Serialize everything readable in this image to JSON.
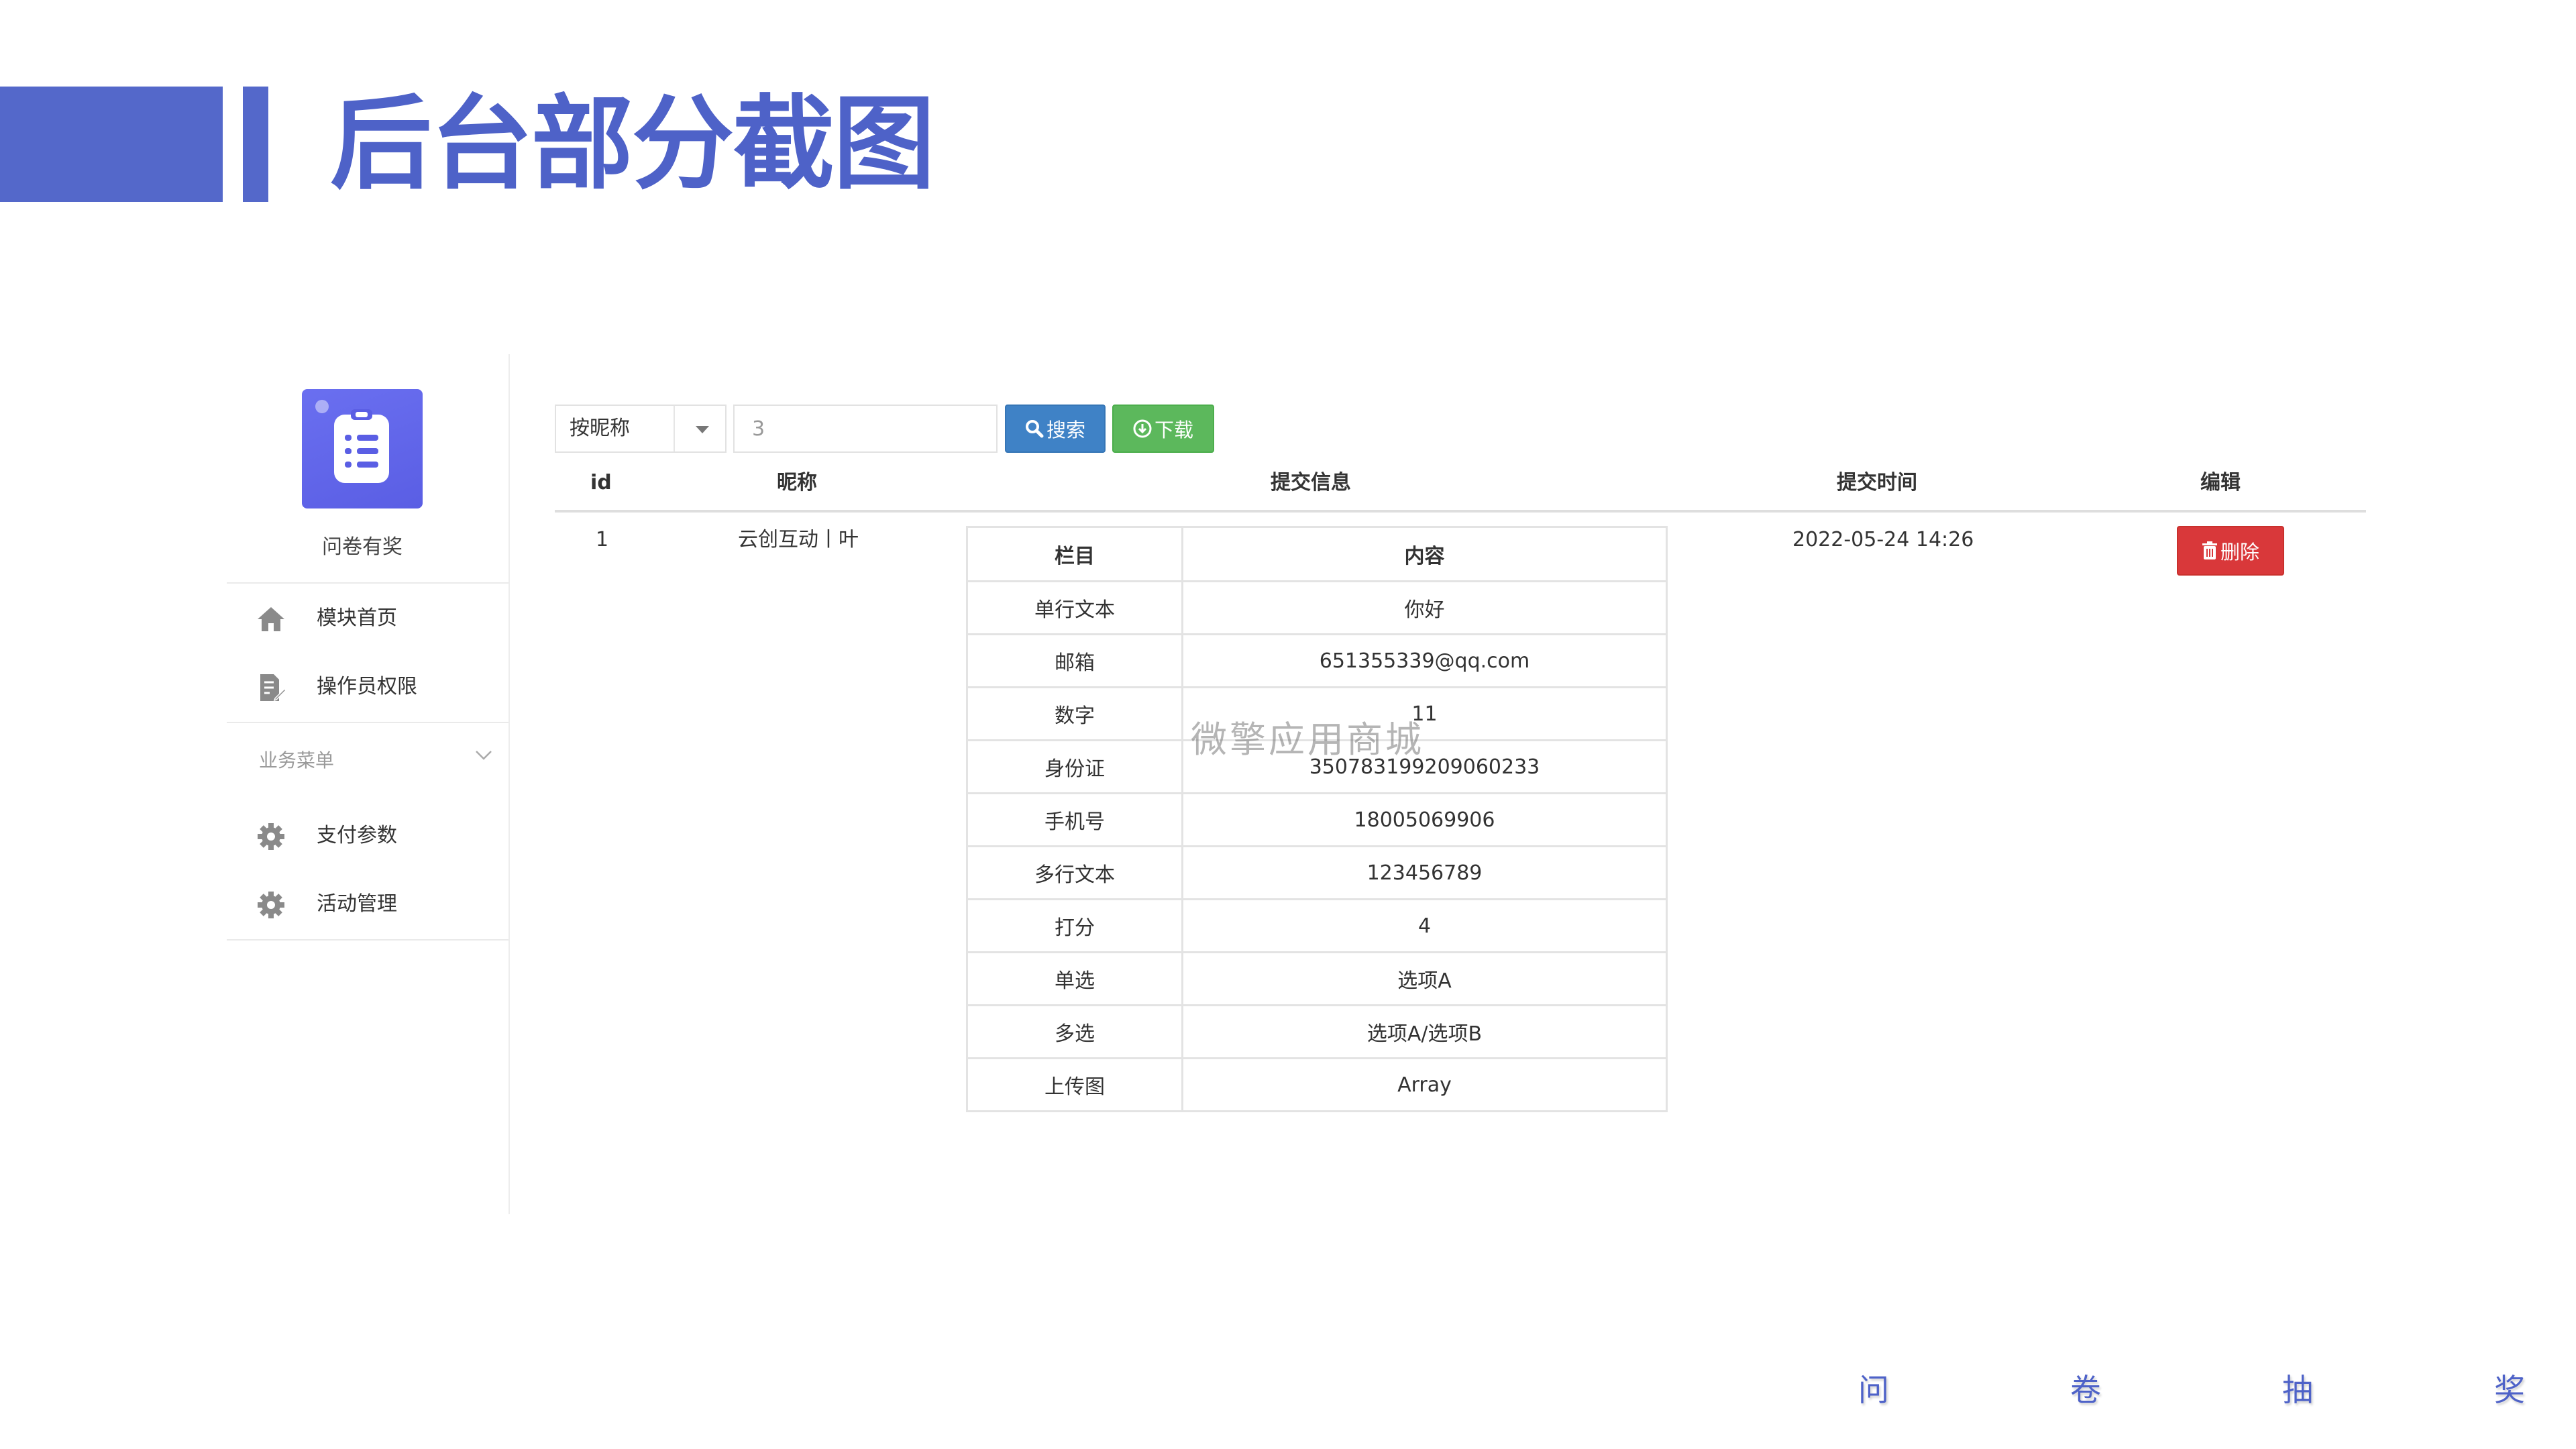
{
  "slide": {
    "title": "后台部分截图",
    "footer": [
      "问",
      "卷",
      "抽",
      "奖"
    ],
    "accent_color": "#5468ca"
  },
  "sidebar": {
    "app_name": "问卷有奖",
    "logo_icon": "clipboard-list-icon",
    "items": [
      {
        "label": "模块首页",
        "icon": "home-icon"
      },
      {
        "label": "操作员权限",
        "icon": "document-edit-icon"
      }
    ],
    "group": {
      "label": "业务菜单",
      "icon": "chevron-down-icon"
    },
    "group_items": [
      {
        "label": "支付参数",
        "icon": "gear-icon"
      },
      {
        "label": "活动管理",
        "icon": "gear-icon"
      }
    ]
  },
  "toolbar": {
    "select_value": "按昵称",
    "search_value": "3",
    "search_button": "搜索",
    "download_button": "下载"
  },
  "table": {
    "headers": [
      "id",
      "昵称",
      "提交信息",
      "提交时间",
      "编辑"
    ],
    "rows": [
      {
        "id": "1",
        "nickname": "云创互动丨叶",
        "submit_time": "2022-05-24 14:26",
        "delete_label": "删除"
      }
    ]
  },
  "detail": {
    "headers": [
      "栏目",
      "内容"
    ],
    "rows": [
      [
        "单行文本",
        "你好"
      ],
      [
        "邮箱",
        "651355339@qq.com"
      ],
      [
        "数字",
        "11"
      ],
      [
        "身份证",
        "350783199209060233"
      ],
      [
        "手机号",
        "18005069906"
      ],
      [
        "多行文本",
        "123456789"
      ],
      [
        "打分",
        "4"
      ],
      [
        "单选",
        "选项A"
      ],
      [
        "多选",
        "选项A/选项B"
      ],
      [
        "上传图",
        "Array"
      ]
    ]
  },
  "watermark": "微擎应用商城",
  "colors": {
    "primary_blue": "#3f82c6",
    "success_green": "#5cb85c",
    "danger_red": "#d9383a",
    "logo_purple": "#5a5ee4"
  }
}
